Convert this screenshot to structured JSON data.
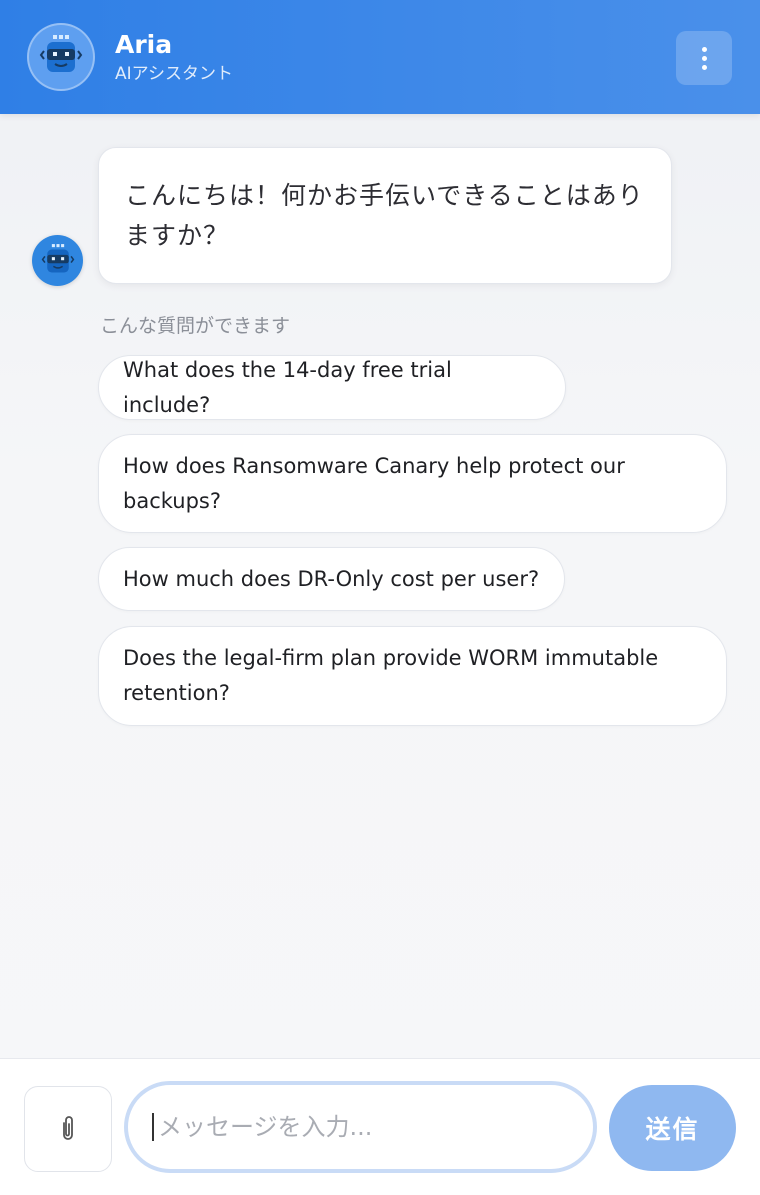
{
  "header": {
    "title": "Aria",
    "subtitle": "AIアシスタント",
    "avatar_icon": "robot-icon",
    "menu_icon": "more-vertical-icon"
  },
  "chat": {
    "bot_avatar_icon": "robot-icon",
    "greeting": "こんにちは！何かお手伝いできることはありますか？",
    "suggestions_label": "こんな質問ができます",
    "suggestions": [
      "What does the 14-day free trial include?",
      "How does Ransomware Canary help protect our backups?",
      "How much does DR-Only cost per user?",
      "Does the legal-firm plan provide WORM immutable retention?"
    ]
  },
  "composer": {
    "attach_icon": "paperclip-icon",
    "placeholder": "メッセージを入力...",
    "value": "",
    "send_label": "送信"
  },
  "colors": {
    "header_start": "#2f7fe6",
    "header_end": "#4a90ea",
    "send_button": "#8fb8f0",
    "input_focus_ring": "#c9dbf6"
  }
}
